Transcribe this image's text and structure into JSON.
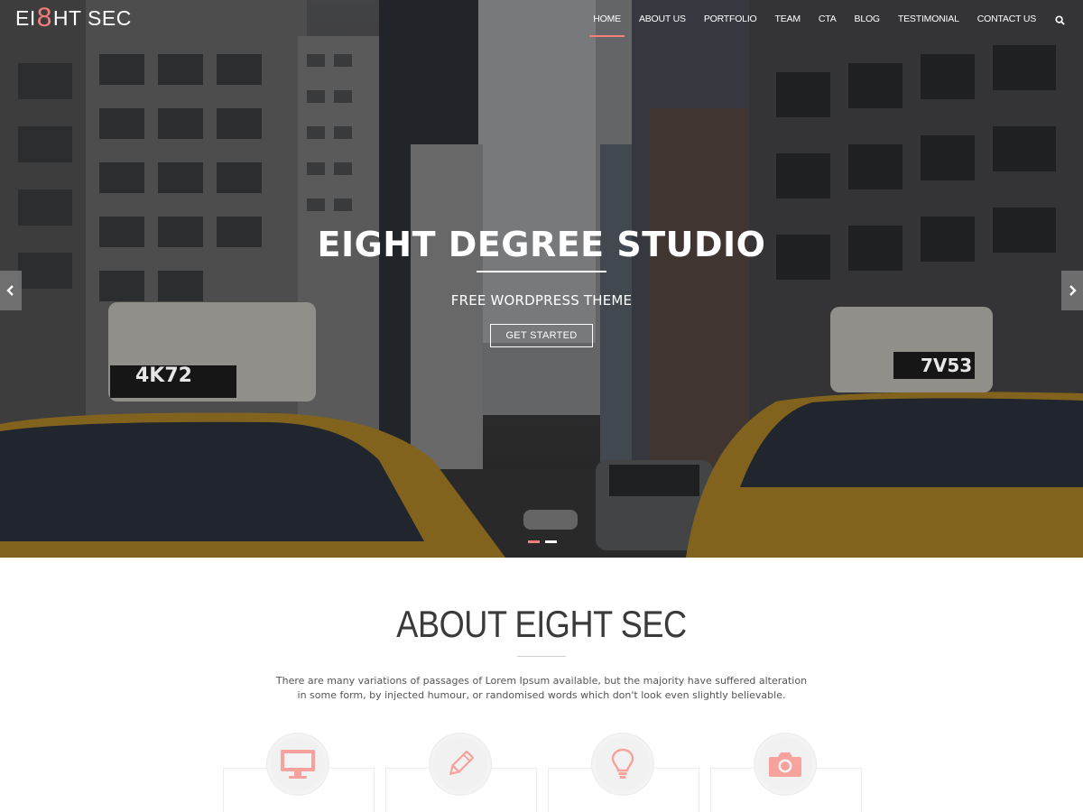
{
  "logo": {
    "part1": "EI",
    "accent": "8",
    "part2": "HT SEC"
  },
  "nav": {
    "items": [
      "HOME",
      "ABOUT US",
      "PORTFOLIO",
      "TEAM",
      "CTA",
      "BLOG",
      "TESTIMONIAL",
      "CONTACT US"
    ],
    "active_index": 0,
    "search_icon": "search-icon"
  },
  "hero": {
    "title": "EIGHT DEGREE STUDIO",
    "subtitle": "FREE WORDPRESS THEME",
    "button": "GET STARTED",
    "taxi_left_plate": "4K72",
    "taxi_right_plate": "7V53",
    "slides": 2,
    "active_slide": 0
  },
  "about": {
    "title": "ABOUT EIGHT SEC",
    "text": "There are many variations of passages of Lorem Ipsum available, but the majority have suffered alteration in some form, by injected humour, or randomised words which don't look even slightly believable."
  },
  "features": [
    {
      "icon": "monitor-icon"
    },
    {
      "icon": "pencil-icon"
    },
    {
      "icon": "lightbulb-icon"
    },
    {
      "icon": "camera-icon"
    }
  ],
  "colors": {
    "accent": "#f47e7a",
    "text": "#3a3a3a"
  }
}
